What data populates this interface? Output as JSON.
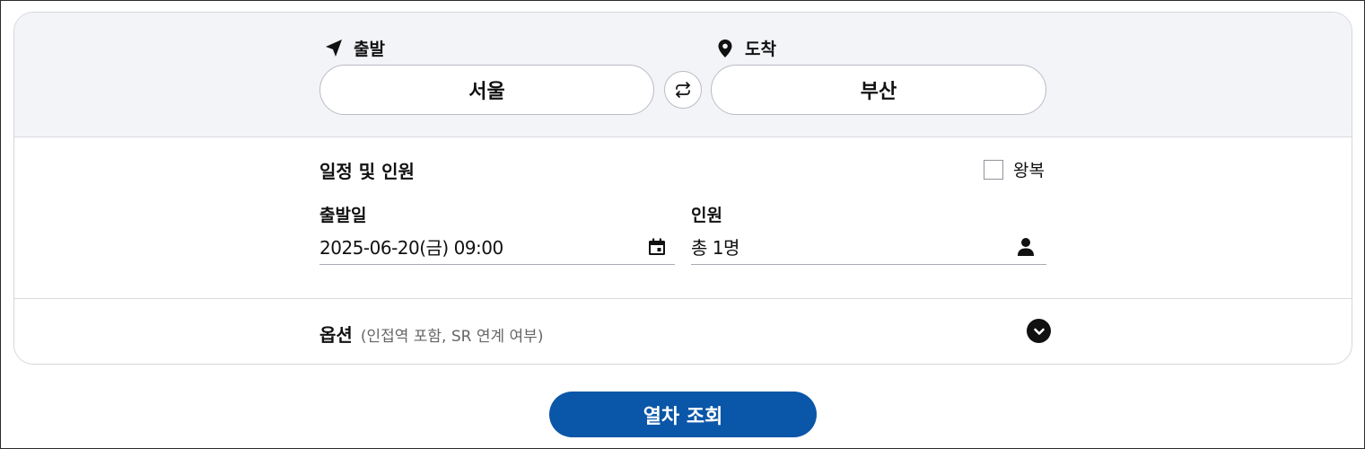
{
  "route": {
    "departure_label": "출발",
    "arrival_label": "도착",
    "departure_station": "서울",
    "arrival_station": "부산"
  },
  "schedule": {
    "title": "일정 및 인원",
    "roundtrip_label": "왕복",
    "roundtrip_checked": false,
    "date_label": "출발일",
    "date_value": "2025-06-20(금) 09:00",
    "passengers_label": "인원",
    "passengers_value": "총 1명"
  },
  "options": {
    "title": "옵션",
    "subtitle": "(인접역 포함, SR 연계 여부)"
  },
  "search": {
    "button_label": "열차 조회"
  },
  "colors": {
    "primary_button": "#0a56a8",
    "route_background": "#f3f4f8"
  },
  "icons": {
    "departure": "navigation-arrow-icon",
    "arrival": "location-pin-icon",
    "swap": "swap-arrows-icon",
    "calendar": "calendar-icon",
    "person": "person-icon",
    "expand": "chevron-down-icon"
  }
}
